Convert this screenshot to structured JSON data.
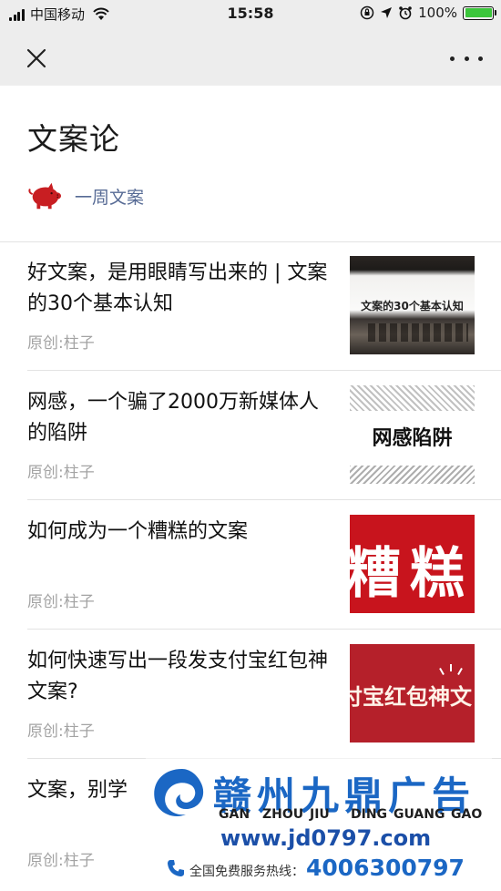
{
  "status_bar": {
    "carrier": "中国移动",
    "time": "15:58",
    "battery_percent": "100%",
    "battery_level": 1.0,
    "battery_color": "#3bc63b"
  },
  "nav": {
    "close_icon": "close-icon",
    "more_icon": "more-icon"
  },
  "header": {
    "title": "文案论",
    "author": "一周文案",
    "author_color": "#576b95"
  },
  "articles": [
    {
      "title": "好文案，是用眼睛写出来的 | 文案的30个基本认知",
      "meta": "原创:柱子",
      "thumb_text": "文案的30个基本认知"
    },
    {
      "title": "网感，一个骗了2000万新媒体人的陷阱",
      "meta": "原创:柱子",
      "thumb_text": "网感陷阱"
    },
    {
      "title": "如何成为一个糟糕的文案",
      "meta": "原创:柱子",
      "thumb_text": "糟糕"
    },
    {
      "title": "如何快速写出一段发支付宝红包神文案?",
      "meta": "原创:柱子",
      "thumb_text": "付宝红包神文"
    },
    {
      "title": "文案，别学",
      "meta": "原创:柱子"
    }
  ],
  "watermark": {
    "name": "赣州九鼎广告",
    "pinyin": [
      "GAN",
      "ZHOU",
      "JIU",
      "DING",
      "GUANG",
      "GAO"
    ],
    "url": "www.jd0797.com",
    "hotline_label": "全国免费服务热线：",
    "phone": "4006300797"
  }
}
